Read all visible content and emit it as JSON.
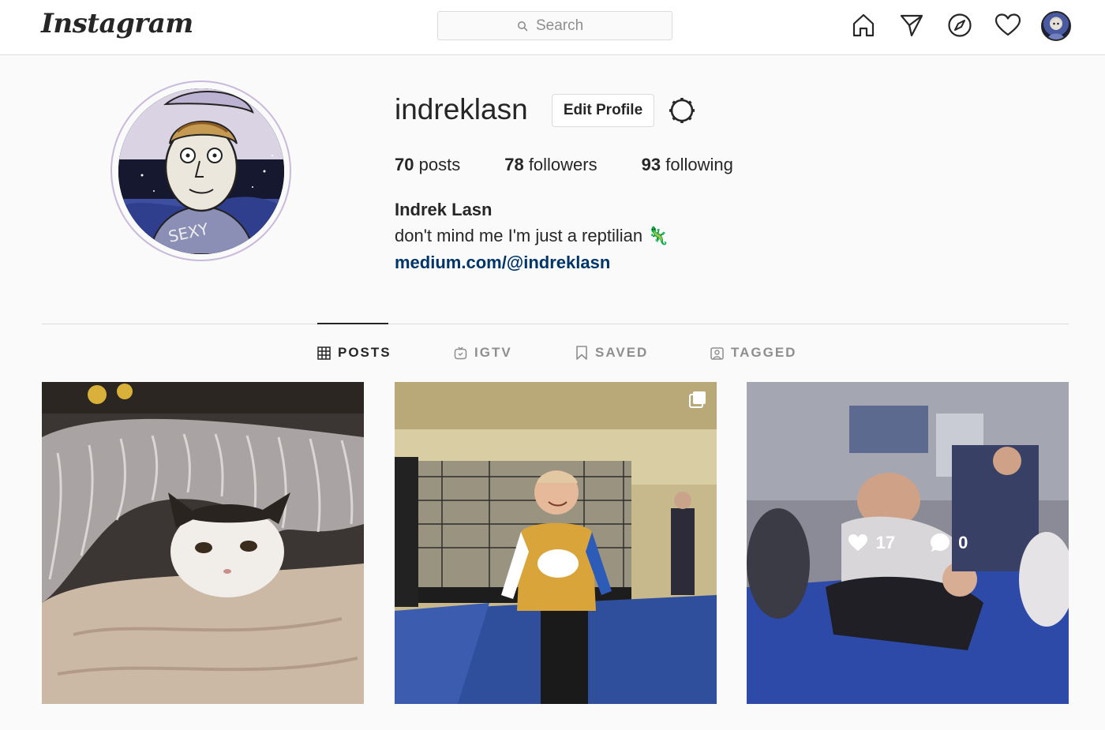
{
  "nav": {
    "logo": "Instagram",
    "search_placeholder": "Search",
    "icons": [
      "home-icon",
      "direct-icon",
      "explore-icon",
      "activity-icon",
      "profile-avatar"
    ]
  },
  "profile": {
    "username": "indreklasn",
    "edit_label": "Edit Profile",
    "stats": {
      "posts_count": "70",
      "posts_label": "posts",
      "followers_count": "78",
      "followers_label": "followers",
      "following_count": "93",
      "following_label": "following"
    },
    "full_name": "Indrek Lasn",
    "bio": "don't mind me I'm just a reptilian 🦎",
    "link": "medium.com/@indreklasn"
  },
  "tabs": [
    {
      "label": "POSTS",
      "icon": "grid-icon",
      "active": true
    },
    {
      "label": "IGTV",
      "icon": "igtv-icon",
      "active": false
    },
    {
      "label": "SAVED",
      "icon": "bookmark-icon",
      "active": false
    },
    {
      "label": "TAGGED",
      "icon": "tagged-icon",
      "active": false
    }
  ],
  "posts": [
    {
      "subject": "cat-under-blanket"
    },
    {
      "subject": "man-in-gym",
      "multiple": true
    },
    {
      "subject": "bjj-class",
      "hover": true,
      "likes": "17",
      "comments": "0"
    }
  ],
  "colors": {
    "background": "#fafafa",
    "border": "#dbdbdb",
    "text": "#262626",
    "muted": "#8e8e8e",
    "link": "#003569",
    "avatar_ring": "#c9b9dc"
  }
}
